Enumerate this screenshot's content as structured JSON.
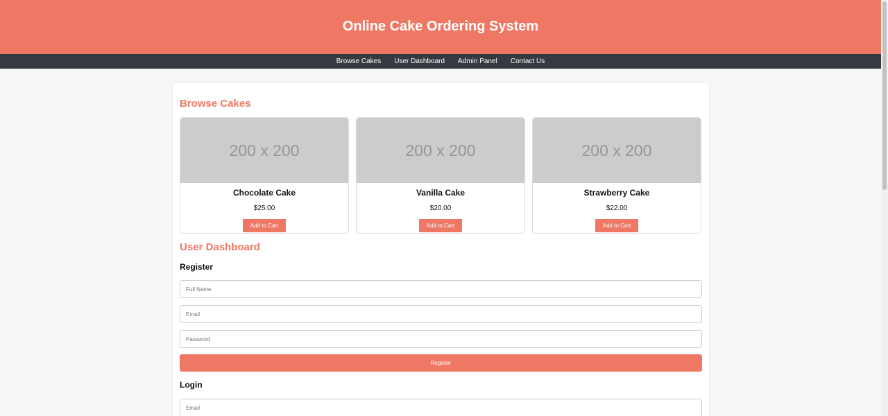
{
  "header": {
    "title": "Online Cake Ordering System"
  },
  "nav": {
    "items": [
      "Browse Cakes",
      "User Dashboard",
      "Admin Panel",
      "Contact Us"
    ]
  },
  "browse": {
    "title": "Browse Cakes",
    "cakes": [
      {
        "image_text": "200 x 200",
        "name": "Chocolate Cake",
        "price": "$25.00",
        "button": "Add to Cart"
      },
      {
        "image_text": "200 x 200",
        "name": "Vanilla Cake",
        "price": "$20.00",
        "button": "Add to Cart"
      },
      {
        "image_text": "200 x 200",
        "name": "Strawberry Cake",
        "price": "$22.00",
        "button": "Add to Cart"
      }
    ]
  },
  "dashboard": {
    "title": "User Dashboard",
    "register": {
      "title": "Register",
      "full_name_placeholder": "Full Name",
      "email_placeholder": "Email",
      "password_placeholder": "Password",
      "button": "Register"
    },
    "login": {
      "title": "Login",
      "email_placeholder": "Email"
    }
  },
  "colors": {
    "accent": "#ef7865",
    "nav_bg": "#343a40",
    "page_bg": "#f4f6f8"
  }
}
